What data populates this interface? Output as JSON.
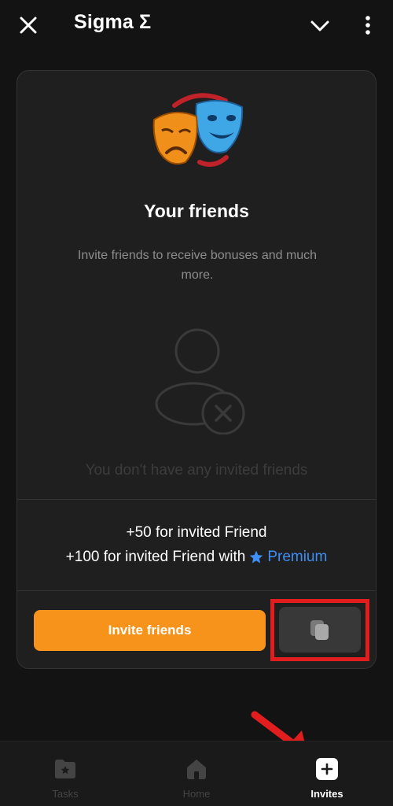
{
  "header": {
    "title": "Sigma Σ",
    "close_icon": "close-icon",
    "dropdown_icon": "chevron-down-icon",
    "more_icon": "more-vertical-icon"
  },
  "card": {
    "title": "Your friends",
    "subtitle": "Invite friends to receive bonuses and much more.",
    "empty_text": "You don't have any invited friends",
    "bonus_line1": "+50 for invited Friend",
    "bonus_line2": "+100 for invited Friend with",
    "premium_label": "Premium",
    "invite_button": "Invite friends",
    "copy_icon": "copy-icon"
  },
  "bottom_nav": {
    "items": [
      {
        "label": "Tasks",
        "icon": "tasks-icon",
        "active": false
      },
      {
        "label": "Home",
        "icon": "home-icon",
        "active": false
      },
      {
        "label": "Invites",
        "icon": "invites-icon",
        "active": true
      }
    ]
  },
  "colors": {
    "accent_orange": "#f7931a",
    "premium_blue": "#3e8ef7",
    "highlight_red": "#e21d1d",
    "background": "#131313",
    "card": "#1f1f1f"
  }
}
